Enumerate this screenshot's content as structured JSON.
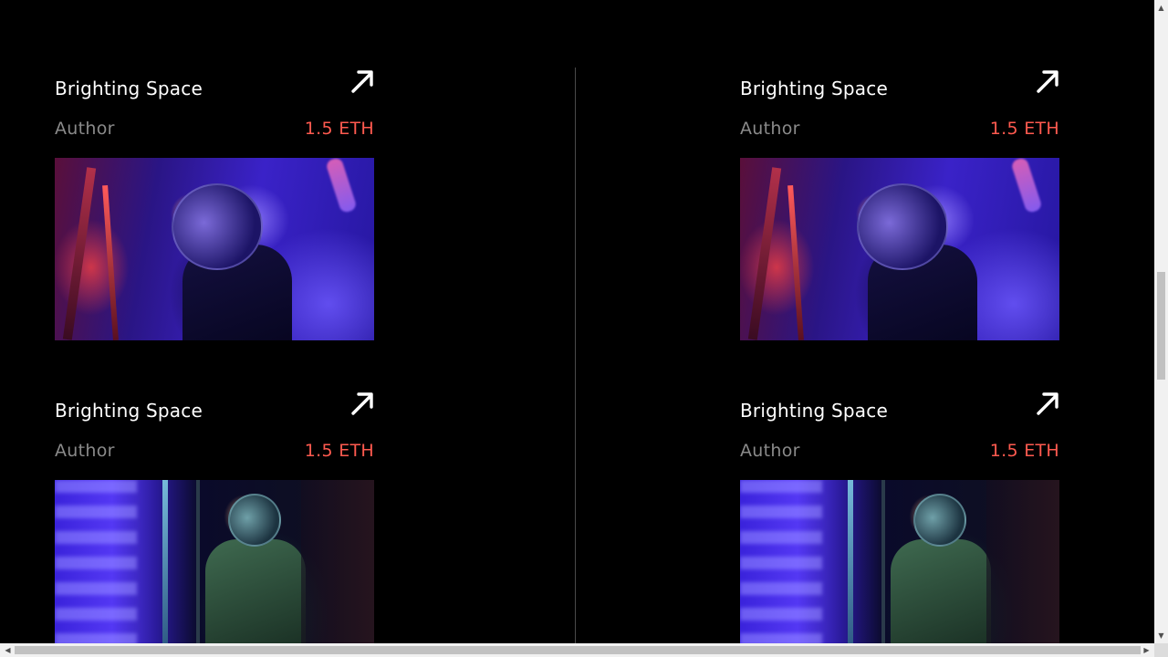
{
  "cards": [
    {
      "title": "Brighting Space",
      "author": "Author",
      "price": "1.5 ETH",
      "image": "astronaut-purple",
      "link_icon": "arrow-up-right-icon"
    },
    {
      "title": "Brighting Space",
      "author": "Author",
      "price": "1.5 ETH",
      "image": "astronaut-purple",
      "link_icon": "arrow-up-right-icon"
    },
    {
      "title": "Brighting Space",
      "author": "Author",
      "price": "1.5 ETH",
      "image": "astronaut-green",
      "link_icon": "arrow-up-right-icon"
    },
    {
      "title": "Brighting Space",
      "author": "Author",
      "price": "1.5 ETH",
      "image": "astronaut-green",
      "link_icon": "arrow-up-right-icon"
    }
  ],
  "colors": {
    "background": "#000000",
    "title": "#ffffff",
    "author": "#8a8a8a",
    "price": "#ff5a4f",
    "divider": "#4a4a4a"
  },
  "scrollbars": {
    "vertical": {
      "up_icon": "triangle-up-icon",
      "down_icon": "triangle-down-icon"
    },
    "horizontal": {
      "left_icon": "triangle-left-icon",
      "right_icon": "triangle-right-icon"
    }
  }
}
